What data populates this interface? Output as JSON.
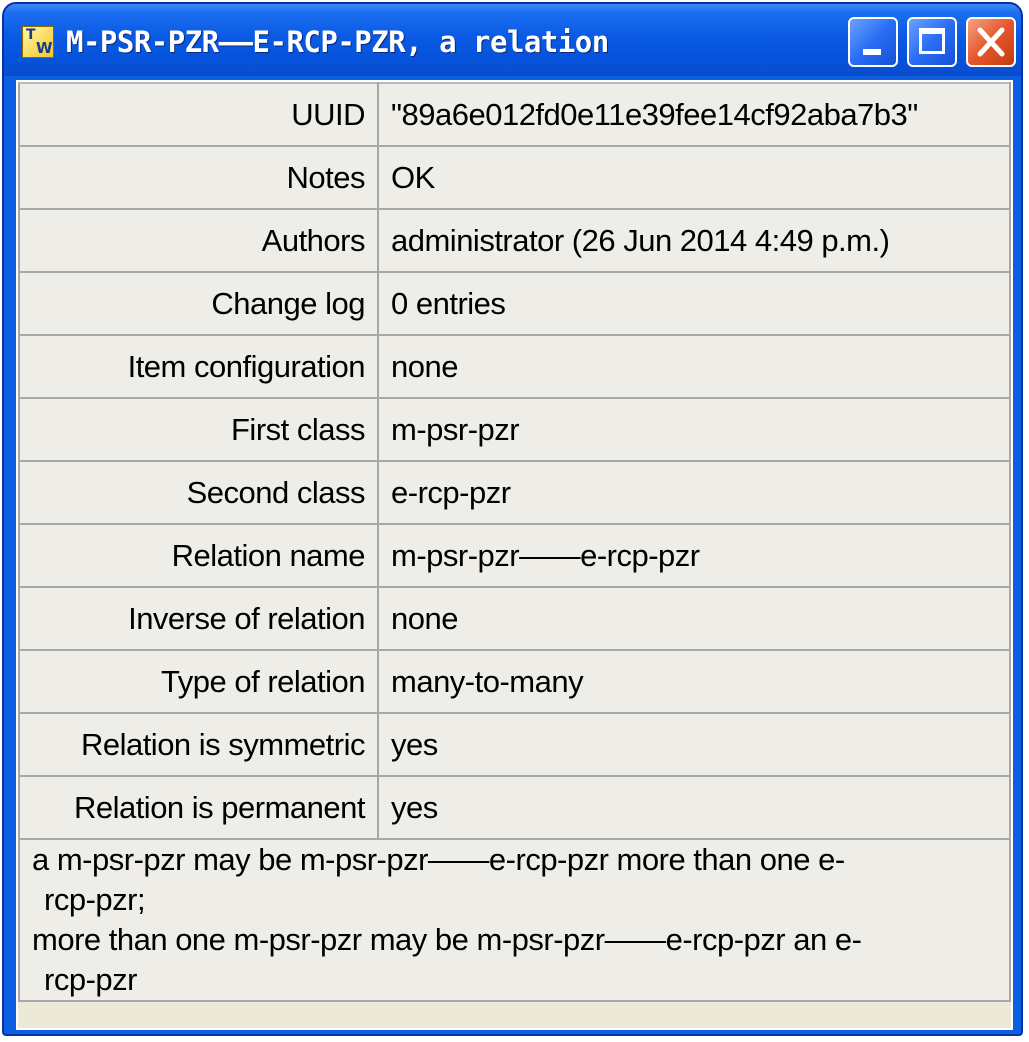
{
  "window": {
    "title": "M-PSR-PZR——E-RCP-PZR, a relation",
    "app_icon": "tw-app-icon",
    "controls": [
      "minimize",
      "maximize",
      "close"
    ]
  },
  "properties": [
    {
      "label": "UUID",
      "value": "\"89a6e012fd0e11e39fee14cf92aba7b3\""
    },
    {
      "label": "Notes",
      "value": "OK"
    },
    {
      "label": "Authors",
      "value": "administrator (26 Jun 2014  4:49 p.m.)"
    },
    {
      "label": "Change log",
      "value": "0 entries"
    },
    {
      "label": "Item configuration",
      "value": "none"
    },
    {
      "label": "First class",
      "value": "m-psr-pzr"
    },
    {
      "label": "Second class",
      "value": "e-rcp-pzr"
    },
    {
      "label": "Relation name",
      "value": "m-psr-pzr——e-rcp-pzr"
    },
    {
      "label": "Inverse of relation",
      "value": "none"
    },
    {
      "label": "Type of relation",
      "value": "many-to-many"
    },
    {
      "label": "Relation is symmetric",
      "value": "yes"
    },
    {
      "label": "Relation is permanent",
      "value": "yes"
    }
  ],
  "description": {
    "lines": [
      "a m-psr-pzr may be m-psr-pzr——e-rcp-pzr more than one e-",
      "rcp-pzr;",
      "more than one m-psr-pzr may be m-psr-pzr——e-rcp-pzr an e-",
      "rcp-pzr"
    ]
  },
  "colors": {
    "title_bar": "#0553dc",
    "client_bg": "#ece9d8",
    "close_button": "#e4572a"
  }
}
